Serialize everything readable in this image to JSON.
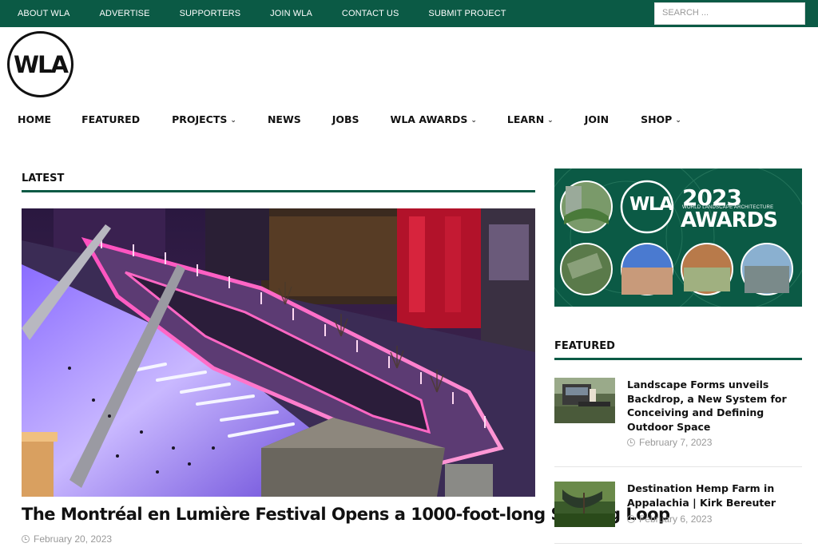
{
  "topbar": {
    "links": [
      "ABOUT WLA",
      "ADVERTISE",
      "SUPPORTERS",
      "JOIN WLA",
      "CONTACT US",
      "SUBMIT PROJECT"
    ],
    "search_placeholder": "SEARCH ..."
  },
  "logo": {
    "text": "WLA"
  },
  "nav": {
    "items": [
      {
        "label": "HOME",
        "dropdown": false
      },
      {
        "label": "FEATURED",
        "dropdown": false
      },
      {
        "label": "PROJECTS",
        "dropdown": true
      },
      {
        "label": "NEWS",
        "dropdown": false
      },
      {
        "label": "JOBS",
        "dropdown": false
      },
      {
        "label": "WLA AWARDS",
        "dropdown": true
      },
      {
        "label": "LEARN",
        "dropdown": true
      },
      {
        "label": "JOIN",
        "dropdown": false
      },
      {
        "label": "SHOP",
        "dropdown": true
      }
    ]
  },
  "latest": {
    "heading": "LATEST",
    "title": "The Montréal en Lumière Festival Opens a 1000-foot-long Skating Loop",
    "date": "February 20, 2023"
  },
  "banner": {
    "logo_text": "WLA",
    "year": "2023",
    "subtitle": "WORLD LANDSCAPE ARCHITECTURE",
    "awards": "AWARDS"
  },
  "featured": {
    "heading": "FEATURED",
    "items": [
      {
        "title": "Landscape Forms unveils Backdrop, a New System for Conceiving and Defining Outdoor Space",
        "date": "February 7, 2023"
      },
      {
        "title": "Destination Hemp Farm in Appalachia | Kirk Bereuter",
        "date": "February 6, 2023"
      }
    ]
  },
  "colors": {
    "brand_green": "#0b5a45"
  }
}
